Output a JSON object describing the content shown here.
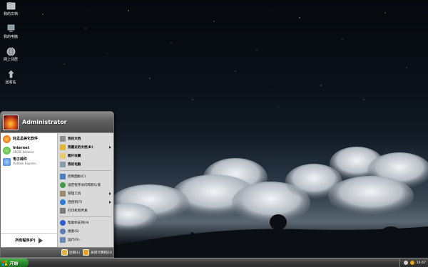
{
  "desktop": {
    "icons": [
      {
        "label": "我的文档",
        "icon": "my-documents-icon"
      },
      {
        "label": "我的电脑",
        "icon": "my-computer-icon"
      },
      {
        "label": "网上邻居",
        "icon": "network-places-icon"
      },
      {
        "label": "回收站",
        "icon": "recycle-bin-icon"
      }
    ]
  },
  "start_menu": {
    "user_name": "Administrator",
    "pinned": [
      {
        "title": "好孟孟美化软件",
        "subtitle": "",
        "icon": "beautify-software-icon",
        "color": "#e0471a"
      },
      {
        "title": "Internet",
        "subtitle": "360SE Browser",
        "icon": "browser-icon",
        "color": "#49a93a"
      },
      {
        "title": "电子邮件",
        "subtitle": "Outlook Express",
        "icon": "email-icon",
        "color": "#3b7fd0"
      }
    ],
    "all_programs": "所有程序(P)",
    "right_items": [
      {
        "label": "我的文档",
        "bold": true,
        "arrow": false,
        "icon": "my-documents-icon",
        "color": "#8f8f8f"
      },
      {
        "label": "我最近的文档(D)",
        "bold": true,
        "arrow": true,
        "icon": "recent-documents-icon",
        "color": "#e2b43a"
      },
      {
        "label": "图片收藏",
        "bold": true,
        "arrow": false,
        "icon": "my-pictures-icon",
        "color": "#e8c870"
      },
      {
        "label": "我的电脑",
        "bold": true,
        "arrow": false,
        "icon": "my-computer-icon",
        "color": "#8a9aa8"
      },
      {
        "label": "控制面板(C)",
        "bold": false,
        "arrow": false,
        "icon": "control-panel-icon",
        "color": "#4c7fbf"
      },
      {
        "label": "设定程序访问和默认值",
        "bold": false,
        "arrow": false,
        "icon": "program-defaults-icon",
        "color": "#3e9a4a"
      },
      {
        "label": "管理工具",
        "bold": false,
        "arrow": true,
        "icon": "admin-tools-icon",
        "color": "#9a8a6a"
      },
      {
        "label": "连接到(T)",
        "bold": false,
        "arrow": true,
        "icon": "connect-to-icon",
        "color": "#2e7bcf"
      },
      {
        "label": "打印机和传真",
        "bold": false,
        "arrow": false,
        "icon": "printer-icon",
        "color": "#7a7a7a"
      },
      {
        "label": "帮助和支持(H)",
        "bold": false,
        "arrow": false,
        "icon": "help-icon",
        "color": "#2e5fcf"
      },
      {
        "label": "搜索(S)",
        "bold": false,
        "arrow": false,
        "icon": "search-icon",
        "color": "#5a7ab0"
      },
      {
        "label": "运行(R)...",
        "bold": false,
        "arrow": false,
        "icon": "run-icon",
        "color": "#6a8ab8"
      }
    ],
    "footer": {
      "logoff_label": "注销(L)",
      "shutdown_label": "关闭计算机(U)"
    }
  },
  "taskbar": {
    "start_label": "开始",
    "clock": "16:47"
  },
  "colors": {
    "start_button": "#2a8a2a",
    "taskbar": "#3c3c3c",
    "menu_right_pane": "#d9d9d9"
  }
}
